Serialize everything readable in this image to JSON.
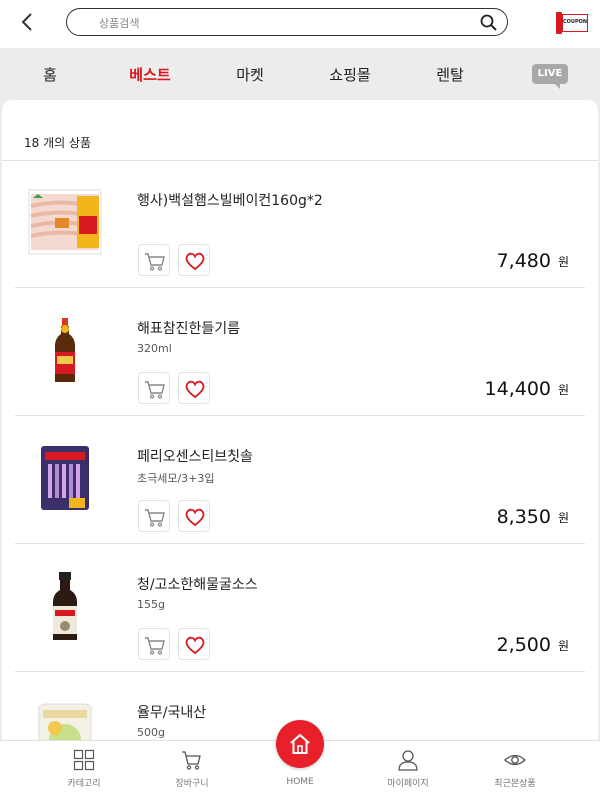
{
  "search": {
    "placeholder": "상품검색",
    "value": ""
  },
  "coupon": {
    "label": "COUPON"
  },
  "tabs": [
    {
      "label": "홈",
      "active": false
    },
    {
      "label": "베스트",
      "active": true
    },
    {
      "label": "마켓",
      "active": false
    },
    {
      "label": "쇼핑몰",
      "active": false
    },
    {
      "label": "렌탈",
      "active": false
    }
  ],
  "live_label": "LIVE",
  "list": {
    "count_text": "18 개의 상품"
  },
  "products": [
    {
      "name": "행사)백설햄스빌베이컨160g*2",
      "desc": "",
      "price": "7,480",
      "unit": "원"
    },
    {
      "name": "해표참진한들기름",
      "desc": "320ml",
      "price": "14,400",
      "unit": "원"
    },
    {
      "name": "페리오센스티브칫솔",
      "desc": "초극세모/3+3입",
      "price": "8,350",
      "unit": "원"
    },
    {
      "name": "청/고소한해물굴소스",
      "desc": "155g",
      "price": "2,500",
      "unit": "원"
    },
    {
      "name": "율무/국내산",
      "desc": "500g",
      "price": "",
      "unit": ""
    }
  ],
  "bottom_nav": {
    "category": "카테고리",
    "cart": "장바구니",
    "home": "HOME",
    "mypage": "마이페이지",
    "recent": "최근본상품"
  },
  "colors": {
    "accent": "#d71920",
    "home_button": "#e8202a",
    "divider": "#e0e0e0"
  }
}
